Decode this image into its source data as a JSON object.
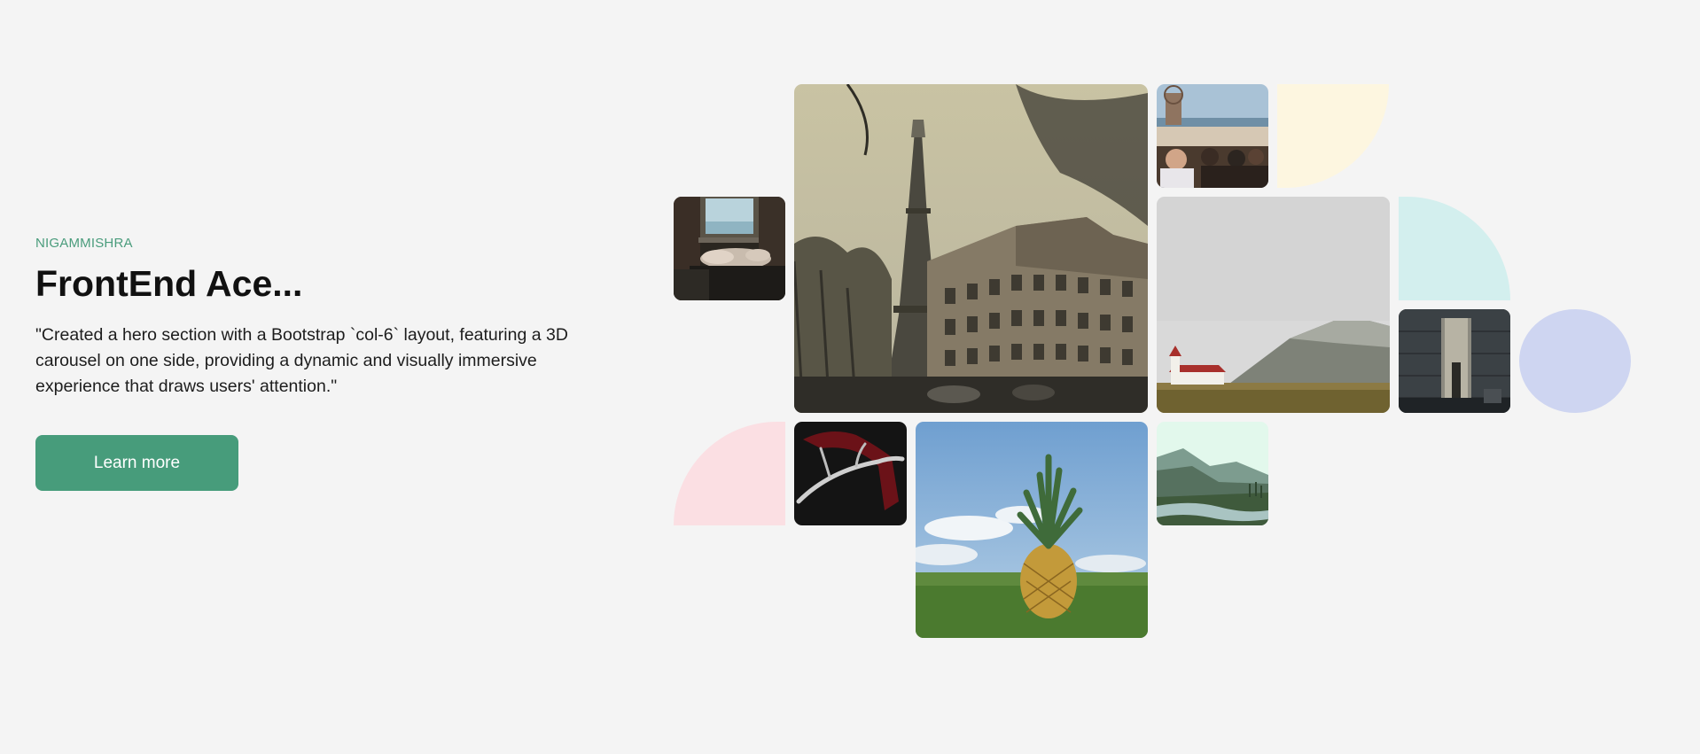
{
  "hero": {
    "eyebrow": "NIGAMMISHRA",
    "title": "FrontEnd Ace...",
    "description": "\"Created a hero section with a Bootstrap `col-6` layout, featuring a 3D carousel on one side, providing a dynamic and visually immersive experience that draws users' attention.\"",
    "cta_label": "Learn more"
  },
  "colors": {
    "background": "#f4f4f4",
    "accent": "#479c7b",
    "eyebrow": "#4a9c7c",
    "shape_cream": "#fdf6e0",
    "shape_mint": "#d3efee",
    "shape_lavender": "#ced5f1",
    "shape_pink": "#fbdfe3"
  },
  "gallery": {
    "photos": [
      {
        "name": "photo-sleeping-woman-window"
      },
      {
        "name": "photo-eiffel-tower-paris"
      },
      {
        "name": "photo-crowd-pier"
      },
      {
        "name": "photo-church-mountain"
      },
      {
        "name": "photo-stone-tower-doorway"
      },
      {
        "name": "photo-antler-red-ribbon"
      },
      {
        "name": "photo-pineapple-grass"
      },
      {
        "name": "photo-misty-valley-river"
      }
    ],
    "shapes": [
      "quarter-circle-cream",
      "quarter-circle-mint",
      "oval-lavender",
      "quarter-circle-pink"
    ]
  }
}
